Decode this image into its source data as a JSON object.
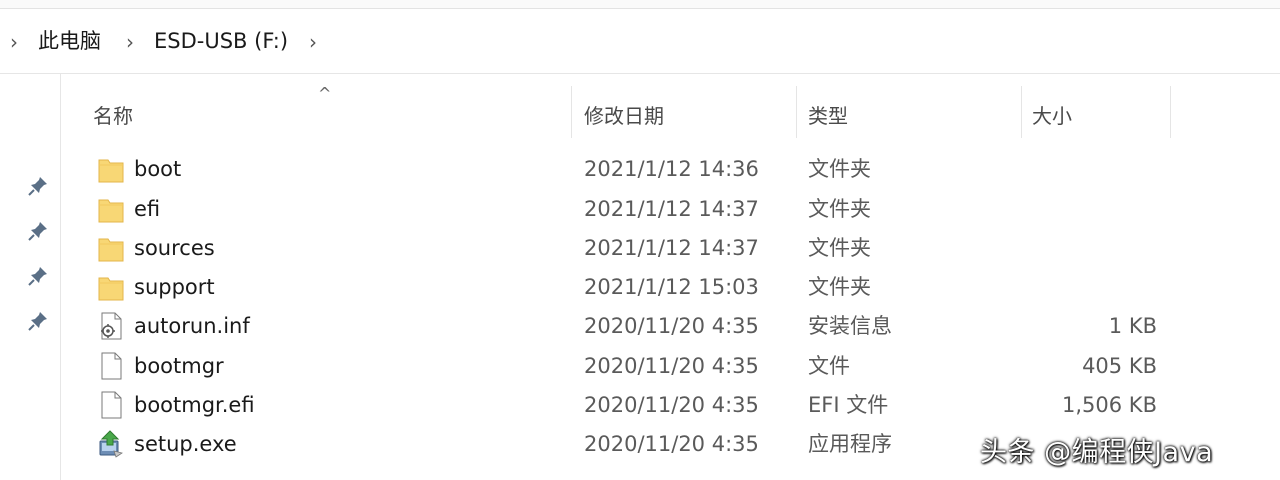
{
  "breadcrumb": {
    "items": [
      "此电脑",
      "ESD-USB (F:)"
    ]
  },
  "columns": {
    "name": "名称",
    "date": "修改日期",
    "type": "类型",
    "size": "大小"
  },
  "files": [
    {
      "name": "boot",
      "date": "2021/1/12 14:36",
      "type": "文件夹",
      "size": "",
      "icon": "folder-icon"
    },
    {
      "name": "efi",
      "date": "2021/1/12 14:37",
      "type": "文件夹",
      "size": "",
      "icon": "folder-icon"
    },
    {
      "name": "sources",
      "date": "2021/1/12 14:37",
      "type": "文件夹",
      "size": "",
      "icon": "folder-icon"
    },
    {
      "name": "support",
      "date": "2021/1/12 15:03",
      "type": "文件夹",
      "size": "",
      "icon": "folder-icon"
    },
    {
      "name": "autorun.inf",
      "date": "2020/11/20 4:35",
      "type": "安装信息",
      "size": "1 KB",
      "icon": "setup-info-icon"
    },
    {
      "name": "bootmgr",
      "date": "2020/11/20 4:35",
      "type": "文件",
      "size": "405 KB",
      "icon": "file-icon"
    },
    {
      "name": "bootmgr.efi",
      "date": "2020/11/20 4:35",
      "type": "EFI 文件",
      "size": "1,506 KB",
      "icon": "file-icon"
    },
    {
      "name": "setup.exe",
      "date": "2020/11/20 4:35",
      "type": "应用程序",
      "size": "",
      "icon": "installer-icon"
    }
  ],
  "watermark": "头条 @编程侠Java",
  "colors": {
    "folder": "#f8d775",
    "folder_dark": "#e7b93f",
    "divider": "#e6e6e6"
  }
}
